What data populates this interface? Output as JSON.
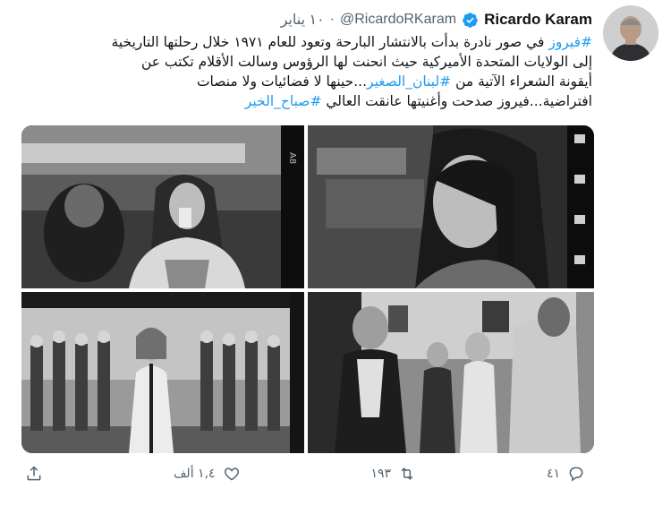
{
  "user": {
    "name": "Ricardo Karam",
    "handle": "@RicardoRKaram",
    "separator": "·",
    "date": "١٠ يناير"
  },
  "tweet": {
    "lines": [
      [
        {
          "t": "#فيروز",
          "tag": true
        },
        {
          "t": " في صور نادرة بدأت بالانتشار البارحة وتعود للعام ١٩٧١ خلال رحلتها التاريخية",
          "tag": false
        }
      ],
      [
        {
          "t": "إلى الولايات المتحدة الأميركية حيث انحنت لها الرؤوس وسالت الأقلام تكتب عن",
          "tag": false
        }
      ],
      [
        {
          "t": "أيقونة الشعراء الآتية من ",
          "tag": false
        },
        {
          "t": "#لبنان_الصغير",
          "tag": true
        },
        {
          "t": "...حينها لا فضائيات ولا منصات",
          "tag": false
        }
      ],
      [
        {
          "t": "افتراضية...فيروز صدحت وأغنيتها عانقت العالي ",
          "tag": false
        },
        {
          "t": "#صباح_الخير",
          "tag": true
        }
      ]
    ]
  },
  "media": {
    "photos": [
      {
        "name": "photo-woman-drinking-glass"
      },
      {
        "name": "photo-woman-portrait-profile"
      },
      {
        "name": "photo-singer-at-microphone-with-dancers"
      },
      {
        "name": "photo-group-reception-room"
      }
    ]
  },
  "actions": {
    "reply_count": "٤١",
    "retweet_count": "١٩٣",
    "like_count": "١,٤ ألف",
    "icons": [
      "reply-icon",
      "retweet-icon",
      "like-icon",
      "share-icon"
    ]
  },
  "colors": {
    "accent": "#1d9bf0",
    "secondary_text": "#536471",
    "primary_text": "#0f1419"
  }
}
